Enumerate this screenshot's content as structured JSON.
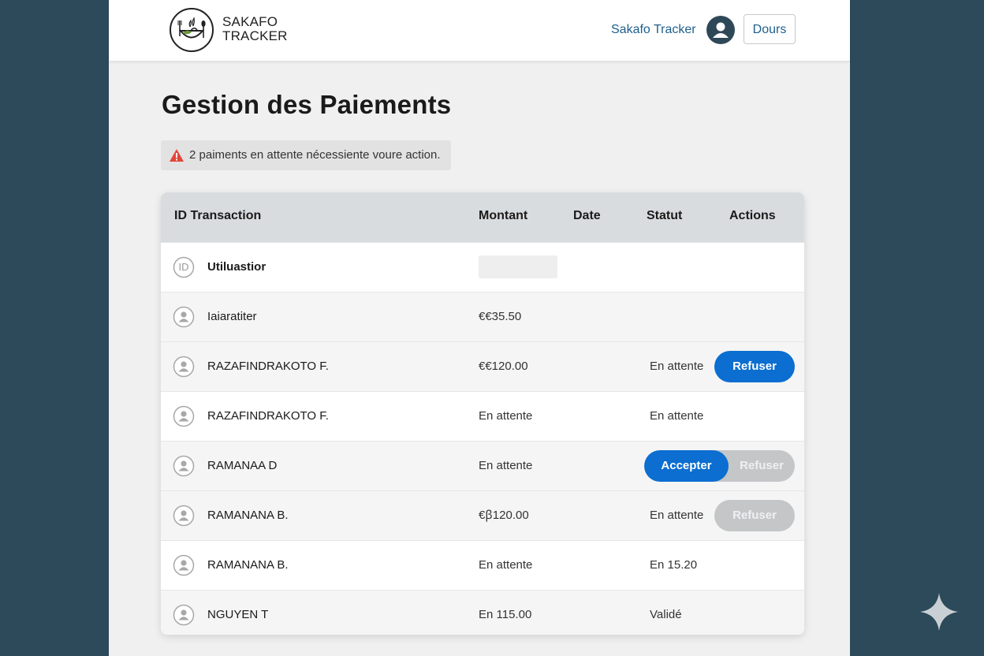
{
  "header": {
    "logo_line1": "SAKAFO",
    "logo_line2": "TRACKER",
    "nav_link": "Sakafo Tracker",
    "user_button": "Dours"
  },
  "page": {
    "title": "Gestion des Paiements",
    "alert_text": "2 paiments en attente nécessiente voure action."
  },
  "table": {
    "headers": {
      "id": "ID Transaction",
      "amount": "Montant",
      "date": "Date",
      "status": "Statut",
      "actions": "Actions"
    },
    "row_id_icon_label": "ID",
    "rows": [
      {
        "name": "Utiluastior",
        "amount": "",
        "status": ""
      },
      {
        "name": "Iaiaratiter",
        "amount": "€€35.50",
        "status": ""
      },
      {
        "name": "RAZAFINDRAKOTO F.",
        "amount": "€€120.00",
        "status": "En attente",
        "action_label": "Refuser"
      },
      {
        "name": "RAZAFINDRAKOTO F.",
        "amount": "En attente",
        "status": "En attente"
      },
      {
        "name": "RAMANAA D",
        "amount": "En attente",
        "status": "",
        "accept_label": "Accepter",
        "refuse_label": "Refuser"
      },
      {
        "name": "RAMANANA B.",
        "amount": "€ꞵ120.00",
        "status": "En attente",
        "action_label": "Refuser"
      },
      {
        "name": "RAMANANA B.",
        "amount": "En attente",
        "status": "En 15.20"
      },
      {
        "name": "NGUYEN T",
        "amount": "En 115.00",
        "status": "Validé"
      }
    ]
  },
  "colors": {
    "background": "#2c4a59",
    "primary_button": "#0b6ed0",
    "disabled_button": "#c4c6c8",
    "link": "#1f5f8b",
    "alert_icon": "#e2463a"
  },
  "icons": {
    "logo": "bowl-fork-spoon-icon",
    "avatar": "user-icon",
    "alert": "warning-triangle-icon",
    "row": "user-circle-icon",
    "corner": "sparkle-icon"
  }
}
